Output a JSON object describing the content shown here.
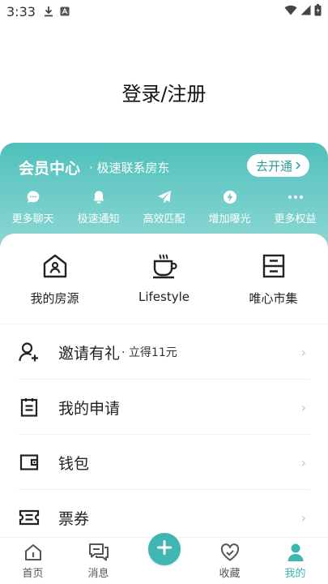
{
  "status_bar": {
    "time": "3:33"
  },
  "header": {
    "login_label": "登录/注册"
  },
  "member": {
    "title": "会员中心",
    "subtitle": "· 极速联系房东",
    "open_button": "去开通",
    "benefits": [
      {
        "label": "更多聊天",
        "icon": "chat-bubble-icon"
      },
      {
        "label": "极速通知",
        "icon": "bell-icon"
      },
      {
        "label": "高效匹配",
        "icon": "paper-plane-icon"
      },
      {
        "label": "增加曝光",
        "icon": "lightning-icon"
      },
      {
        "label": "更多权益",
        "icon": "more-dots-icon"
      }
    ]
  },
  "quick_actions": [
    {
      "label": "我的房源",
      "icon": "house-icon"
    },
    {
      "label": "Lifestyle",
      "icon": "coffee-cup-icon"
    },
    {
      "label": "唯心市集",
      "icon": "cabinet-icon"
    }
  ],
  "menu": [
    {
      "label": "邀请有礼",
      "sub": "· 立得11元",
      "icon": "invite-user-icon"
    },
    {
      "label": "我的申请",
      "icon": "clipboard-icon"
    },
    {
      "label": "钱包",
      "icon": "wallet-icon"
    },
    {
      "label": "票券",
      "icon": "ticket-icon"
    }
  ],
  "tabbar": {
    "home": "首页",
    "messages": "消息",
    "favorites": "收藏",
    "mine": "我的"
  },
  "colors": {
    "accent": "#3fb6b1",
    "member_gradient_top": "#4fc0bb",
    "member_gradient_bottom": "#8dd8d4"
  }
}
